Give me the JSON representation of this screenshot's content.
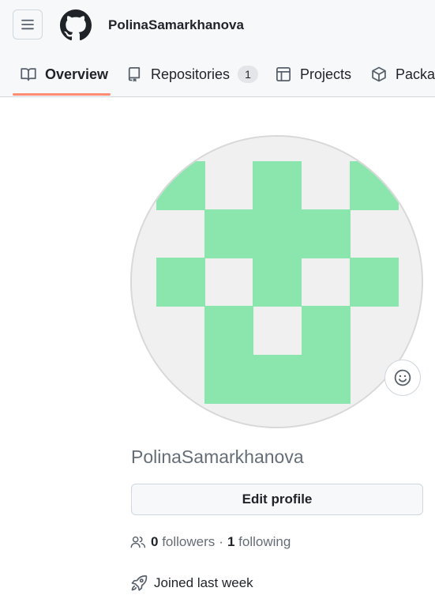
{
  "header": {
    "username": "PolinaSamarkhanova"
  },
  "tabs": [
    {
      "label": "Overview",
      "icon": "book-icon",
      "selected": true
    },
    {
      "label": "Repositories",
      "icon": "repo-icon",
      "counter": "1"
    },
    {
      "label": "Projects",
      "icon": "table-icon"
    },
    {
      "label": "Packages",
      "icon": "package-icon"
    }
  ],
  "profile": {
    "username": "PolinaSamarkhanova",
    "edit_label": "Edit profile",
    "followers_count": "0",
    "followers_label": "followers",
    "separator": "·",
    "following_count": "1",
    "following_label": "following",
    "joined": "Joined last week"
  },
  "colors": {
    "identicon": "#8ae6ad",
    "identicon_bg": "#f0f0f0",
    "tab_underline": "#fd8c73",
    "header_bg": "#f6f8fa"
  }
}
